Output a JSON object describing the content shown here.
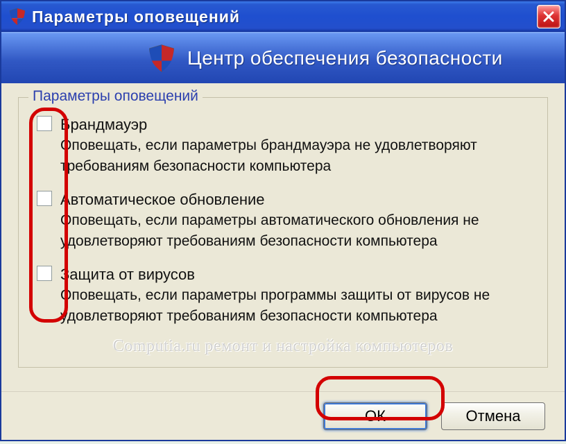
{
  "titlebar": {
    "title": "Параметры оповещений"
  },
  "header": {
    "title": "Центр обеспечения безопасности"
  },
  "group": {
    "legend": "Параметры оповещений",
    "options": [
      {
        "title": "Брандмауэр",
        "desc": "Оповещать, если параметры брандмауэра не удовлетворяют требованиям безопасности компьютера",
        "checked": false
      },
      {
        "title": "Автоматическое обновление",
        "desc": "Оповещать, если параметры автоматического обновления не удовлетворяют требованиям безопасности компьютера",
        "checked": false
      },
      {
        "title": "Защита от вирусов",
        "desc": "Оповещать, если параметры программы защиты от вирусов не удовлетворяют требованиям безопасности компьютера",
        "checked": false
      }
    ]
  },
  "watermark": "Computia.ru ремонт и настройка компьютеров",
  "buttons": {
    "ok": "ОК",
    "cancel": "Отмена"
  }
}
